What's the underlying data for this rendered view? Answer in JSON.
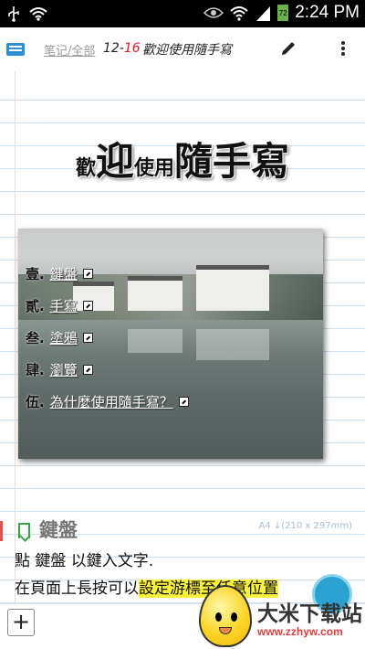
{
  "status_bar": {
    "time": "2:24 PM",
    "battery_level": "72",
    "icons": [
      "usb-icon",
      "wifi-icon",
      "eye-icon",
      "wifi-signal-icon",
      "cell-signal-icon",
      "battery-icon"
    ]
  },
  "toolbar": {
    "breadcrumb": "笔记/全部",
    "date_month": "12",
    "date_day": "16",
    "title": "歡迎使用隨手寫",
    "icons": [
      "menu-icon",
      "pen-icon",
      "more-vert-icon"
    ]
  },
  "page": {
    "welcome": {
      "p1": "歡",
      "p2": "迎",
      "p3": "使用",
      "p4": "隨手寫"
    },
    "menu": [
      {
        "num": "壹.",
        "label": "鍵盤"
      },
      {
        "num": "貳.",
        "label": "手寫"
      },
      {
        "num": "叁.",
        "label": "塗鴉"
      },
      {
        "num": "肆.",
        "label": "瀏覽"
      },
      {
        "num": "伍.",
        "label": "為什麼使用隨手寫？"
      }
    ],
    "section_title": "鍵盤",
    "paper_size": "A4 ↓(210 x 297mm)",
    "body_line1": "點 鍵盤 以鍵入文字.",
    "body_line2_plain": "在頁面上長按可以",
    "body_line2_highlight": "設定游標至任意位置"
  },
  "bottom_bar": {
    "add_label": "+"
  },
  "watermark": {
    "text": "大米下载站",
    "url": "www.zzhyw.com"
  },
  "colors": {
    "accent_blue": "#2d8fd5",
    "date_red": "#d22222",
    "highlight": "#fbf33a",
    "bookmark_green": "#3aa545",
    "rule_line": "#cfe0ef"
  }
}
